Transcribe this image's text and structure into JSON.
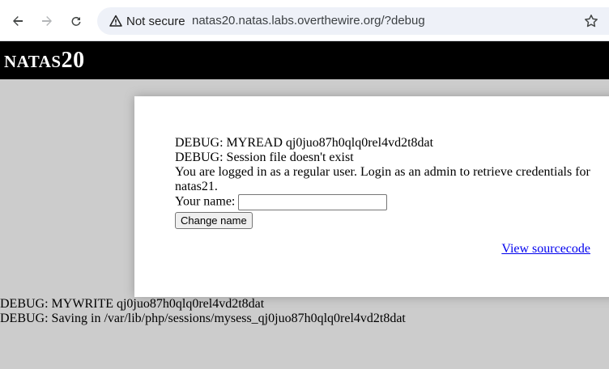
{
  "browser": {
    "security_label": "Not secure",
    "url": "natas20.natas.labs.overthewire.org/?debug",
    "icons": [
      "back-arrow-icon",
      "forward-arrow-icon",
      "reload-icon",
      "warning-triangle-icon",
      "bookmark-star-icon"
    ]
  },
  "header": {
    "title_prefix": "NATAS",
    "title_number": "20"
  },
  "content": {
    "debug_read": "DEBUG: MYREAD qj0juo87h0qlq0rel4vd2t8dat",
    "debug_session": "DEBUG: Session file doesn't exist",
    "status_message": "You are logged in as a regular user. Login as an admin to retrieve credentials for natas21.",
    "name_label": "Your name:",
    "name_value": "",
    "submit_label": "Change name",
    "source_link": "View sourcecode"
  },
  "debug_footer": {
    "write_line": "DEBUG: MYWRITE qj0juo87h0qlq0rel4vd2t8dat",
    "save_line": "DEBUG: Saving in /var/lib/php/sessions/mysess_qj0juo87h0qlq0rel4vd2t8dat"
  },
  "colors": {
    "page_background": "#cccccc",
    "header_background": "#000000",
    "link": "#0000ee"
  }
}
